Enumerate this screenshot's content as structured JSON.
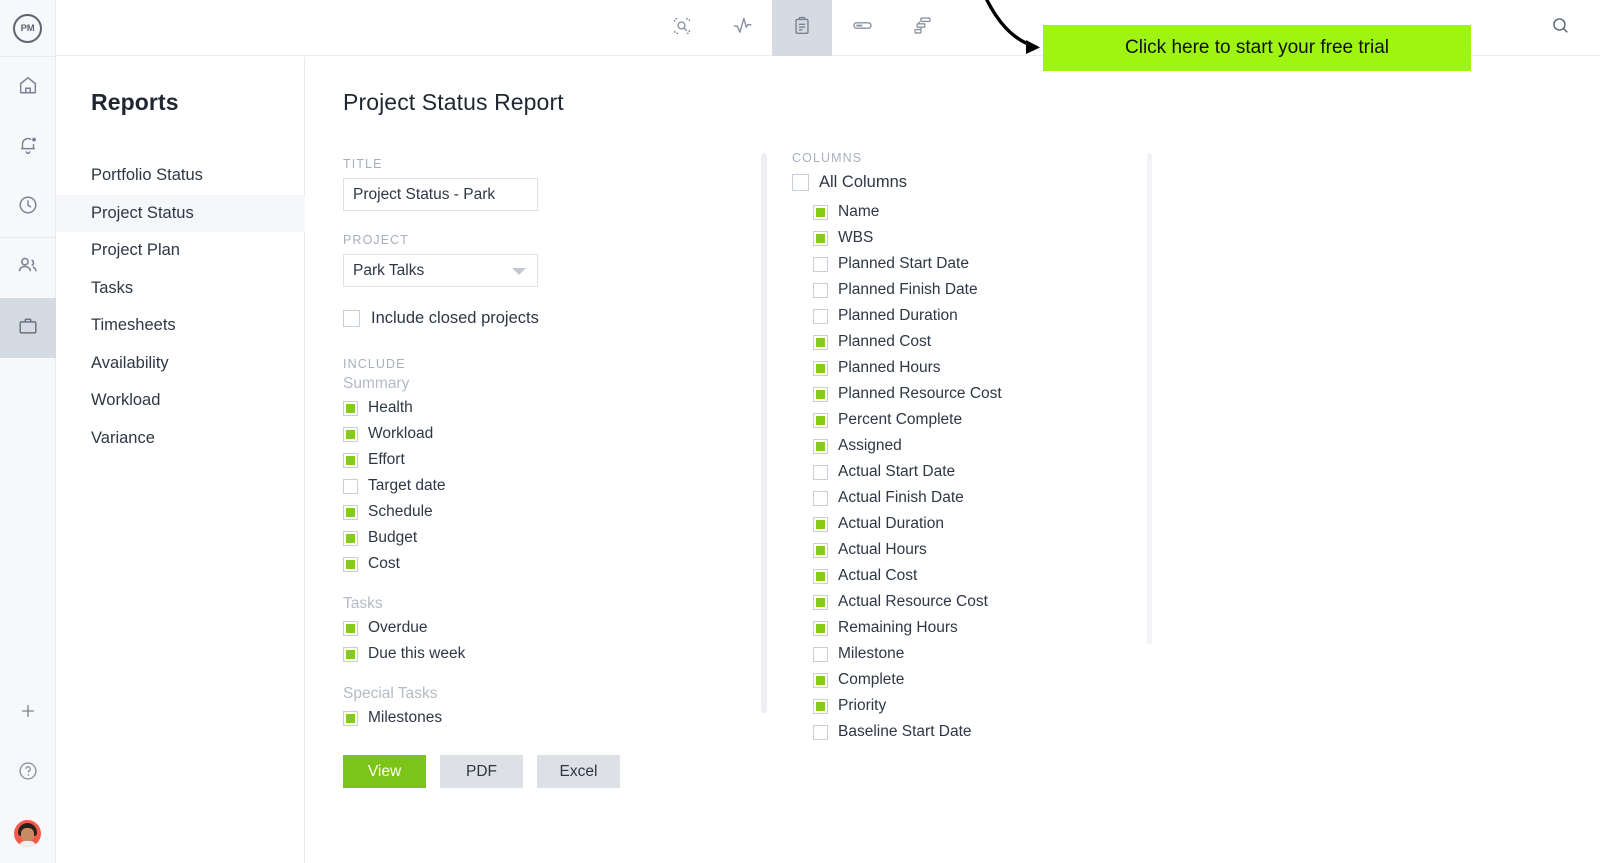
{
  "rail": {
    "logo_text": "PM",
    "items": [
      {
        "name": "home-icon",
        "label": "Home"
      },
      {
        "name": "notifications-icon",
        "label": "Notifications"
      },
      {
        "name": "time-icon",
        "label": "Time"
      },
      {
        "name": "people-icon",
        "label": "Team"
      },
      {
        "name": "projects-icon",
        "label": "Projects",
        "active": true
      }
    ],
    "bottom_items": [
      {
        "name": "add-icon",
        "label": "Add"
      },
      {
        "name": "help-icon",
        "label": "Help"
      },
      {
        "name": "avatar",
        "label": "Account"
      }
    ]
  },
  "header": {
    "tools": [
      {
        "name": "overview-zoom-icon",
        "label": "Overview",
        "active": false
      },
      {
        "name": "pulse-chart-icon",
        "label": "Pulse",
        "active": false
      },
      {
        "name": "clipboard-reports-icon",
        "label": "Reports",
        "active": true
      },
      {
        "name": "card-view-icon",
        "label": "Cards",
        "active": false
      },
      {
        "name": "gantt-chart-icon",
        "label": "Gantt",
        "active": false
      }
    ],
    "search_icon": "search-icon"
  },
  "sidebar": {
    "title": "Reports",
    "items": [
      {
        "label": "Portfolio Status",
        "active": false
      },
      {
        "label": "Project Status",
        "active": true
      },
      {
        "label": "Project Plan",
        "active": false
      },
      {
        "label": "Tasks",
        "active": false
      },
      {
        "label": "Timesheets",
        "active": false
      },
      {
        "label": "Availability",
        "active": false
      },
      {
        "label": "Workload",
        "active": false
      },
      {
        "label": "Variance",
        "active": false
      }
    ]
  },
  "main": {
    "page_title": "Project Status Report",
    "title_field": {
      "label": "TITLE",
      "value": "Project Status - Park"
    },
    "project_field": {
      "label": "PROJECT",
      "value": "Park Talks"
    },
    "include_closed": {
      "label": "Include closed projects",
      "checked": false
    },
    "include_caption": "INCLUDE",
    "groups": [
      {
        "heading": "Summary",
        "options": [
          {
            "label": "Health",
            "checked": true
          },
          {
            "label": "Workload",
            "checked": true
          },
          {
            "label": "Effort",
            "checked": true
          },
          {
            "label": "Target date",
            "checked": false
          },
          {
            "label": "Schedule",
            "checked": true
          },
          {
            "label": "Budget",
            "checked": true
          },
          {
            "label": "Cost",
            "checked": true
          }
        ]
      },
      {
        "heading": "Tasks",
        "options": [
          {
            "label": "Overdue",
            "checked": true
          },
          {
            "label": "Due this week",
            "checked": true
          }
        ]
      },
      {
        "heading": "Special Tasks",
        "options": [
          {
            "label": "Milestones",
            "checked": true
          }
        ]
      }
    ],
    "buttons": {
      "view": "View",
      "pdf": "PDF",
      "excel": "Excel"
    },
    "columns": {
      "caption": "COLUMNS",
      "all_columns": {
        "label": "All Columns",
        "checked": false
      },
      "items": [
        {
          "label": "Name",
          "checked": true
        },
        {
          "label": "WBS",
          "checked": true
        },
        {
          "label": "Planned Start Date",
          "checked": false
        },
        {
          "label": "Planned Finish Date",
          "checked": false
        },
        {
          "label": "Planned Duration",
          "checked": false
        },
        {
          "label": "Planned Cost",
          "checked": true
        },
        {
          "label": "Planned Hours",
          "checked": true
        },
        {
          "label": "Planned Resource Cost",
          "checked": true
        },
        {
          "label": "Percent Complete",
          "checked": true
        },
        {
          "label": "Assigned",
          "checked": true
        },
        {
          "label": "Actual Start Date",
          "checked": false
        },
        {
          "label": "Actual Finish Date",
          "checked": false
        },
        {
          "label": "Actual Duration",
          "checked": true
        },
        {
          "label": "Actual Hours",
          "checked": true
        },
        {
          "label": "Actual Cost",
          "checked": true
        },
        {
          "label": "Actual Resource Cost",
          "checked": true
        },
        {
          "label": "Remaining Hours",
          "checked": true
        },
        {
          "label": "Milestone",
          "checked": false
        },
        {
          "label": "Complete",
          "checked": true
        },
        {
          "label": "Priority",
          "checked": true
        },
        {
          "label": "Baseline Start Date",
          "checked": false
        }
      ]
    }
  },
  "promo": {
    "banner_text": "Click here to start your free trial",
    "banner_color": "#9EF511",
    "arrow_icon": "curved-arrow-icon"
  },
  "colors": {
    "accent_green": "#86CB18",
    "button_green": "#7CC418",
    "promo_green": "#9EF511",
    "text_dark": "#2E3744",
    "text_muted": "#A8B0BB"
  }
}
